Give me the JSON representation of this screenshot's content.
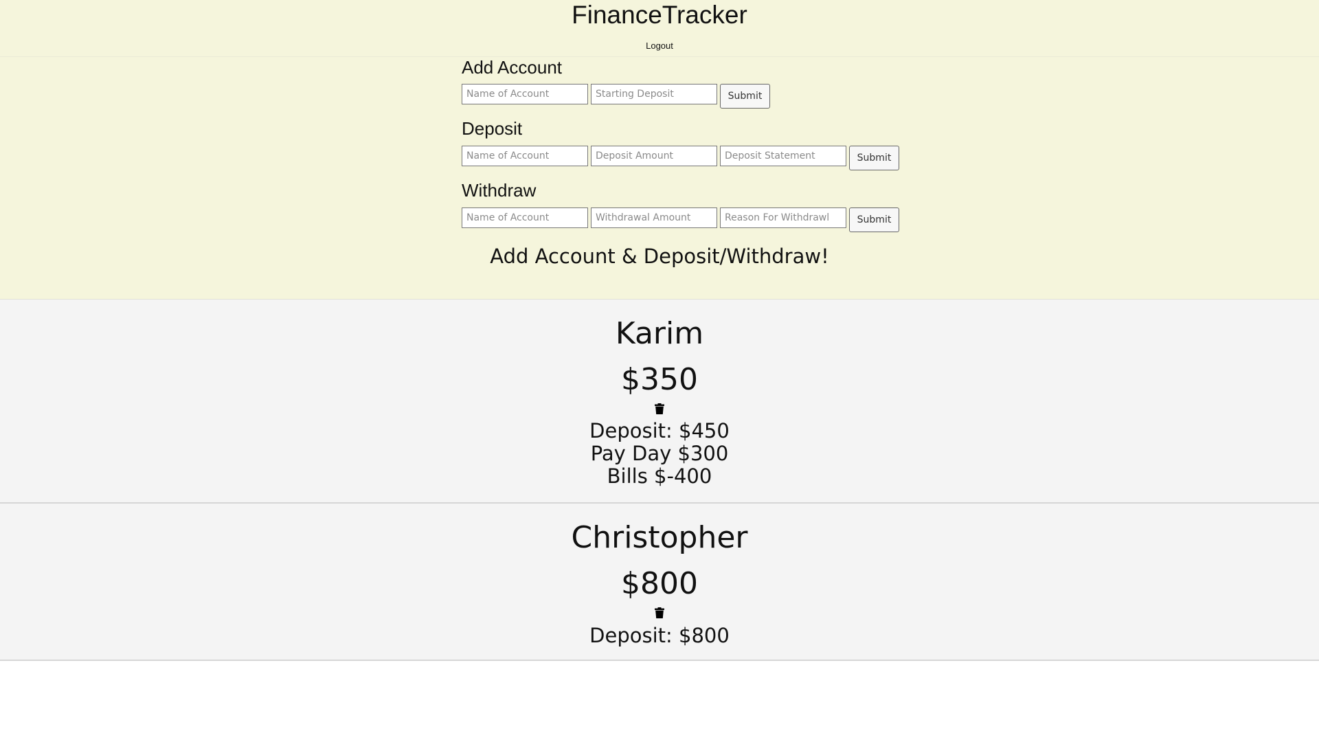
{
  "header": {
    "title": "FinanceTracker",
    "logout_label": "Logout"
  },
  "forms": {
    "add_account": {
      "title": "Add Account",
      "name_placeholder": "Name of Account",
      "deposit_placeholder": "Starting Deposit",
      "submit_label": "Submit"
    },
    "deposit": {
      "title": "Deposit",
      "name_placeholder": "Name of Account",
      "amount_placeholder": "Deposit Amount",
      "statement_placeholder": "Deposit Statement",
      "submit_label": "Submit"
    },
    "withdraw": {
      "title": "Withdraw",
      "name_placeholder": "Name of Account",
      "amount_placeholder": "Withdrawal Amount",
      "reason_placeholder": "Reason For Withdrawl",
      "submit_label": "Submit"
    }
  },
  "tagline": "Add Account & Deposit/Withdraw!",
  "accounts": [
    {
      "name": "Karim",
      "balance": "$350",
      "transactions": [
        "Deposit: $450",
        "Pay Day $300",
        "Bills $-400"
      ]
    },
    {
      "name": "Christopher",
      "balance": "$800",
      "transactions": [
        "Deposit: $800"
      ]
    }
  ],
  "icons": {
    "delete": "trash-icon"
  }
}
